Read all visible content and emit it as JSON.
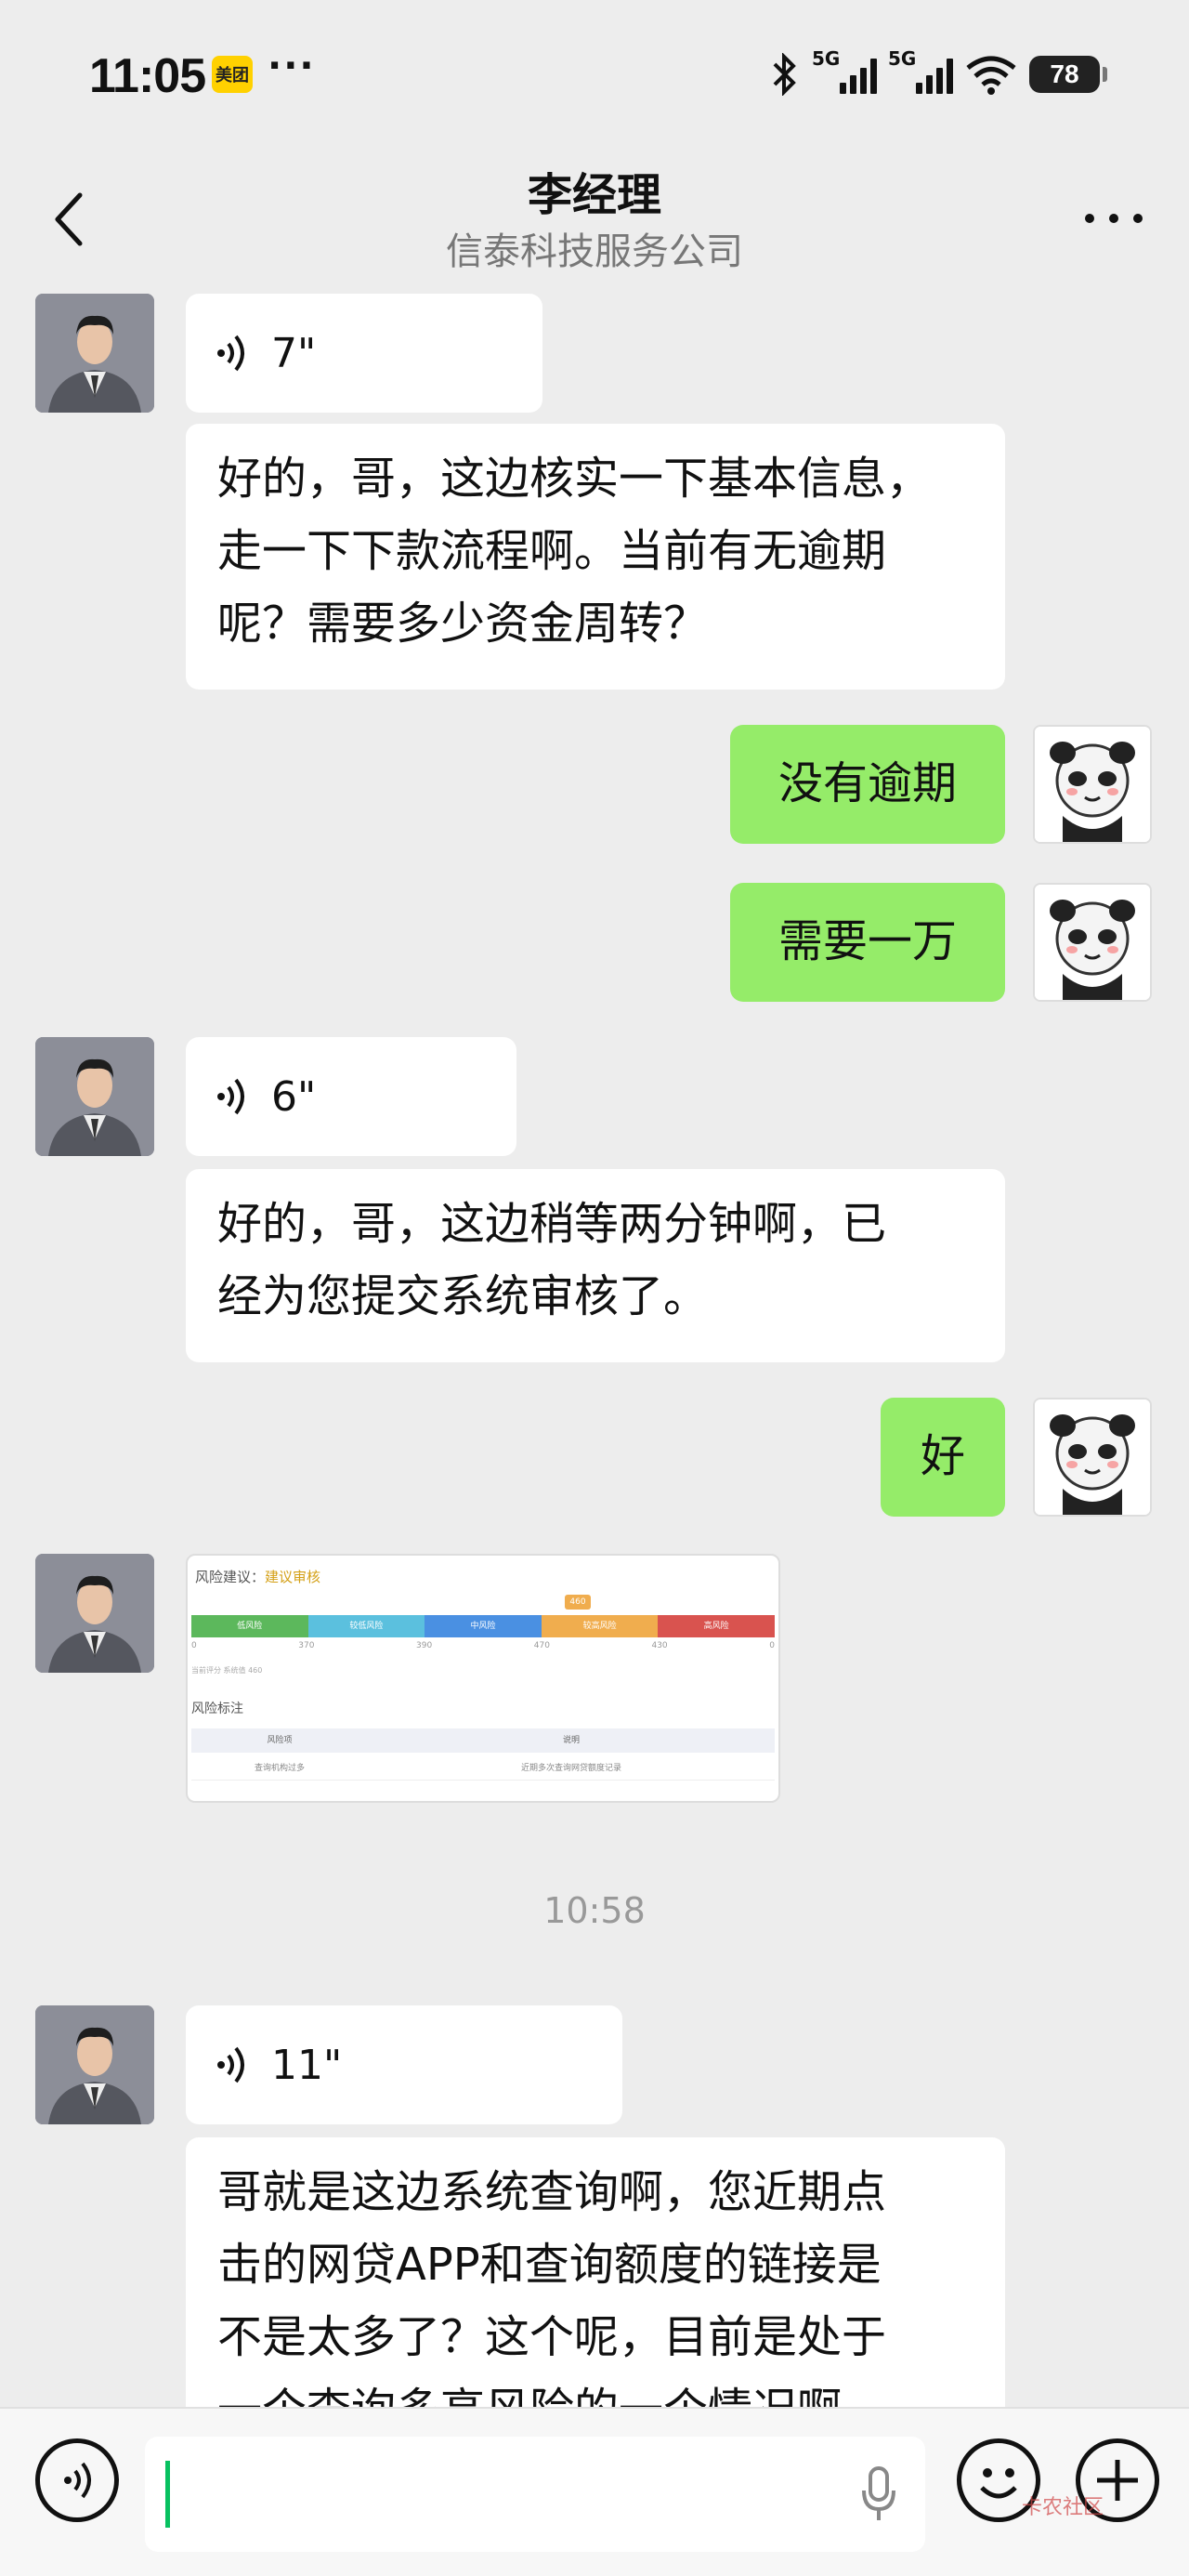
{
  "status_bar": {
    "time": "11:05",
    "app_badge": "美团",
    "more": "···",
    "network_1": "5G",
    "network_2": "5G",
    "battery": "78"
  },
  "header": {
    "title": "李经理",
    "subtitle": "信泰科技服务公司"
  },
  "messages": {
    "m1_voice": "7\"",
    "m2_text_1": "好的，哥，这边核实一下基本信息，",
    "m2_text_2": "走一下下款流程啊。当前有无逾期",
    "m2_text_3": "呢？需要多少资金周转？",
    "m3_text": "没有逾期",
    "m4_text": "需要一万",
    "m5_voice": "6\"",
    "m6_text_1": "好的，哥，这边稍等两分钟啊，已",
    "m6_text_2": "经为您提交系统审核了。",
    "m7_text": "好",
    "m9_timestamp": "10:58",
    "m10_voice": "11\"",
    "m11_text_1": "哥就是这边系统查询啊，您近期点",
    "m11_text_2": "击的网贷APP和查询额度的链接是",
    "m11_text_3": "不是太多了？这个呢，目前是处于",
    "m11_text_4": "一个查询多高风险的一个情况啊"
  },
  "image_card": {
    "risk_label": "风险建议：",
    "risk_value": "建议审核",
    "segments": [
      "低风险",
      "较低风险",
      "中风险",
      "较高风险",
      "高风险"
    ],
    "segment_colors": [
      "#5cb85c",
      "#5bc0de",
      "#4a90e2",
      "#f0ad4e",
      "#d9534f"
    ],
    "tick_values": [
      "0",
      "370",
      "390",
      "470",
      "430",
      "0"
    ],
    "marker": "460",
    "small_note": "当前评分 系统值 460",
    "section_title": "风险标注",
    "table_head": [
      "风险项",
      "说明"
    ],
    "table_row": [
      "查询机构过多",
      "近期多次查询网贷额度记录"
    ]
  },
  "input": {
    "placeholder": ""
  },
  "watermark": "卡农社区",
  "colors": {
    "background": "#ededed",
    "my_bubble": "#95ec69",
    "their_bubble": "#ffffff",
    "caret": "#07c160"
  }
}
